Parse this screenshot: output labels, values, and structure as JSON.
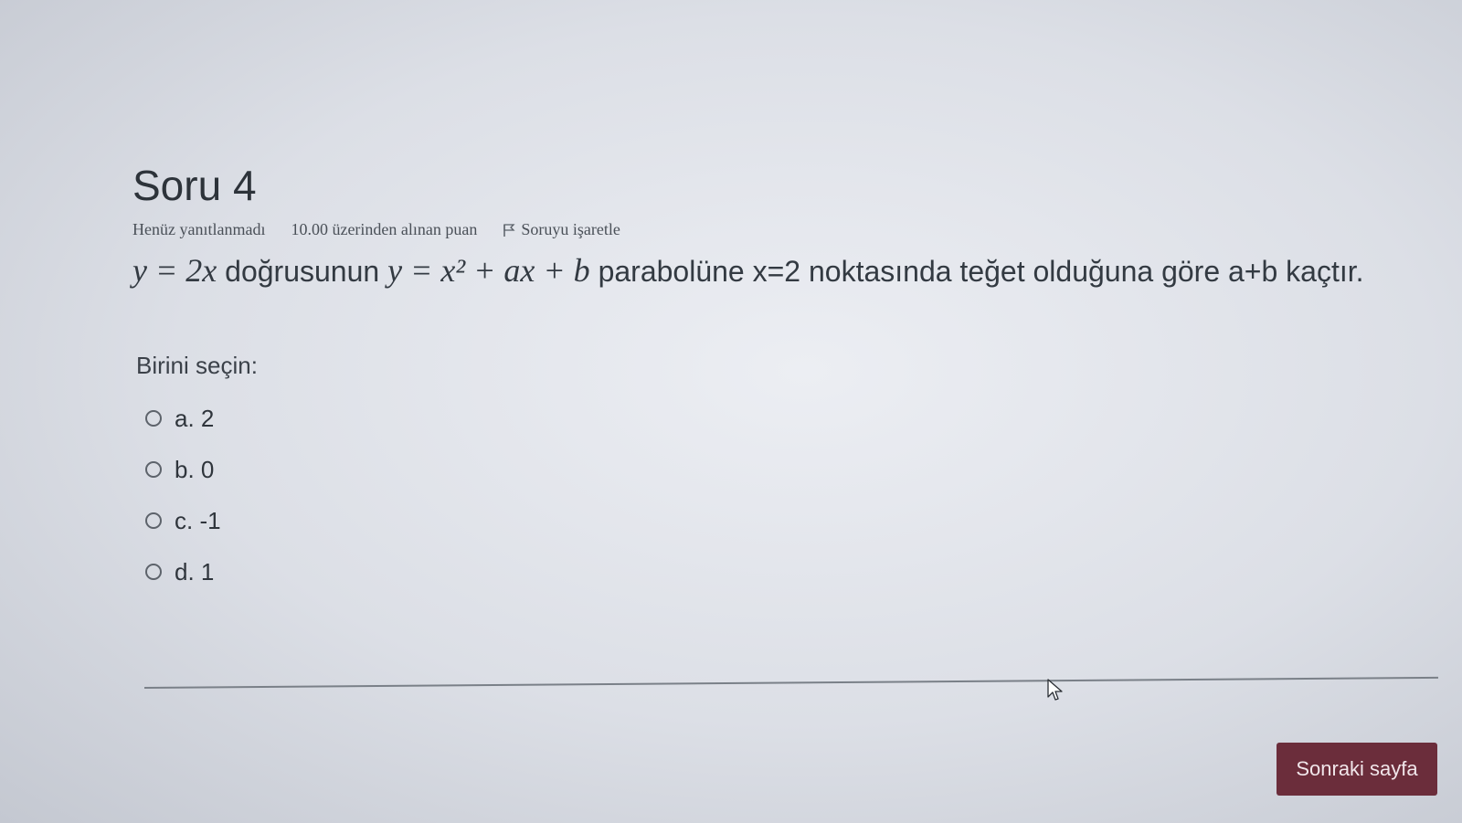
{
  "question": {
    "title": "Soru 4",
    "status": "Henüz yanıtlanmadı",
    "points": "10.00 üzerinden alınan puan",
    "flag_label": "Soruyu işaretle",
    "text_math_1": "y = 2x",
    "text_part_1": "doğrusunun",
    "text_math_2": "y = x² + ax + b",
    "text_part_2": "parabolüne x=2 noktasında teğet olduğuna göre a+b kaçtır.",
    "prompt": "Birini seçin:",
    "answers": [
      {
        "label": "a. 2"
      },
      {
        "label": "b. 0"
      },
      {
        "label": "c. -1"
      },
      {
        "label": "d. 1"
      }
    ]
  },
  "navigation": {
    "next_label": "Sonraki sayfa"
  },
  "icons": {
    "flag": "flag-icon",
    "radio": "radio-unchecked-icon",
    "cursor": "mouse-pointer-icon"
  },
  "colors": {
    "next_button_bg": "#6b2d3b",
    "text": "#333a42"
  }
}
